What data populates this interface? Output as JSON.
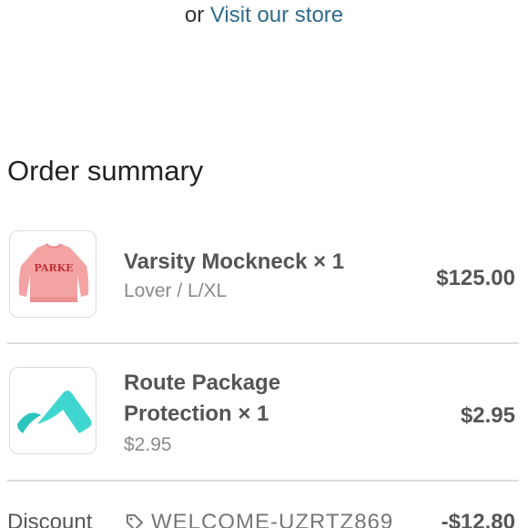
{
  "store": {
    "prefix": "or",
    "link_label": "Visit our store"
  },
  "summary": {
    "title": "Order summary",
    "items": [
      {
        "name": "Varsity Mockneck × 1",
        "variant": "Lover / L/XL",
        "price": "$125.00",
        "thumbnail_text": "PARKE",
        "thumbnail_icon": "sweater-icon"
      },
      {
        "name_line1": "Route Package",
        "name_line2": "Protection × 1",
        "variant": "$2.95",
        "price": "$2.95",
        "thumbnail_icon": "route-logo-icon"
      }
    ],
    "discount": {
      "label": "Discount",
      "code": "WELCOME-UZRTZ869",
      "amount": "-$12.80",
      "icon": "tag-icon"
    }
  },
  "colors": {
    "link": "#2f6b8a",
    "sweater": "#f29e9e",
    "sweater_text": "#c0303a",
    "route_teal": "#3fd6cf"
  }
}
